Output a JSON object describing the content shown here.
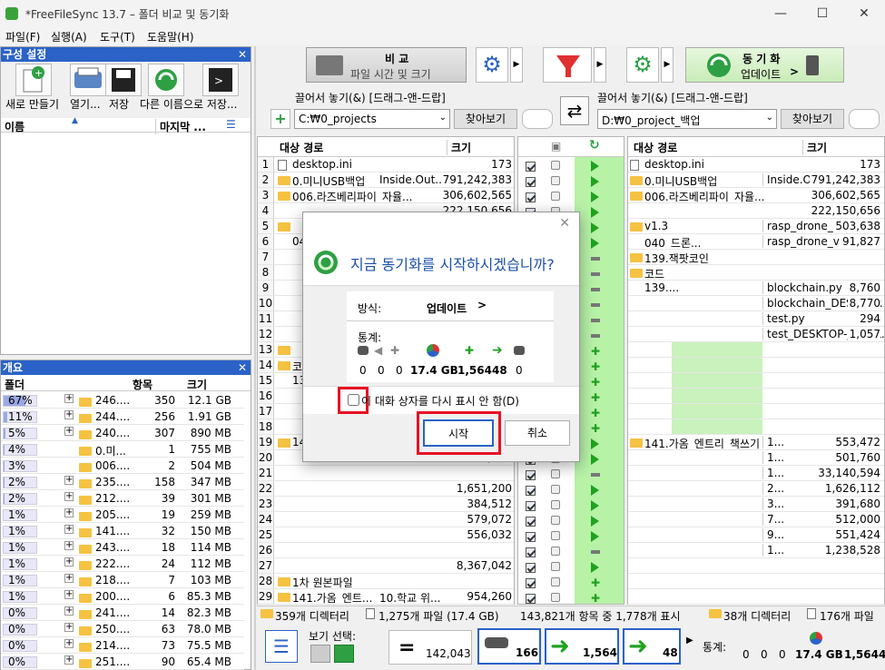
{
  "window": {
    "title": "*FreeFileSync 13.7 – 폴더 비교 및 동기화",
    "min": "—",
    "max": "☐",
    "close": "✕"
  },
  "menu": [
    "파일(F)",
    "실행(A)",
    "도구(T)",
    "도움말(H)"
  ],
  "config_panel": {
    "title": "구성 설정",
    "buttons": [
      "새로 만들기",
      "열기...",
      "저장",
      "다른 이름으로 저장..."
    ],
    "col_name": "이름",
    "col_last": "마지막 ...",
    "close": "✕"
  },
  "overview": {
    "title": "개요",
    "cols": [
      "폴더",
      "항목",
      "크기"
    ],
    "rows": [
      {
        "pct": "67%",
        "name": "246....",
        "items": "350",
        "size": "12.1 GB",
        "fill": 0.67
      },
      {
        "pct": "11%",
        "name": "244....",
        "items": "256",
        "size": "1.91 GB",
        "fill": 0.11
      },
      {
        "pct": "5%",
        "name": "240....",
        "items": "307",
        "size": "890 MB",
        "fill": 0.05
      },
      {
        "pct": "4%",
        "name": "0.미...",
        "items": "1",
        "size": "755 MB",
        "fill": 0.04
      },
      {
        "pct": "3%",
        "name": "006....",
        "items": "2",
        "size": "504 MB",
        "fill": 0.03
      },
      {
        "pct": "2%",
        "name": "235....",
        "items": "158",
        "size": "347 MB",
        "fill": 0.02
      },
      {
        "pct": "2%",
        "name": "212....",
        "items": "39",
        "size": "301 MB",
        "fill": 0.02
      },
      {
        "pct": "1%",
        "name": "205....",
        "items": "19",
        "size": "259 MB",
        "fill": 0.01
      },
      {
        "pct": "1%",
        "name": "141....",
        "items": "32",
        "size": "150 MB",
        "fill": 0.01
      },
      {
        "pct": "1%",
        "name": "243....",
        "items": "18",
        "size": "114 MB",
        "fill": 0.01
      },
      {
        "pct": "1%",
        "name": "222....",
        "items": "24",
        "size": "112 MB",
        "fill": 0.01
      },
      {
        "pct": "1%",
        "name": "218....",
        "items": "7",
        "size": "103 MB",
        "fill": 0.01
      },
      {
        "pct": "1%",
        "name": "200....",
        "items": "6",
        "size": "85.3 MB",
        "fill": 0.01
      },
      {
        "pct": "0%",
        "name": "241....",
        "items": "14",
        "size": "82.3 MB",
        "fill": 0.0
      },
      {
        "pct": "0%",
        "name": "250....",
        "items": "63",
        "size": "78.0 MB",
        "fill": 0.0
      },
      {
        "pct": "0%",
        "name": "214....",
        "items": "73",
        "size": "75.5 MB",
        "fill": 0.0
      },
      {
        "pct": "0%",
        "name": "251....",
        "items": "90",
        "size": "65.4 MB",
        "fill": 0.0
      }
    ]
  },
  "toolbar": {
    "compare_title": "비 교",
    "compare_sub": "파일 시간 및 크기",
    "sync_title": "동 기 화",
    "sync_sub": "업데이트"
  },
  "left_folder": {
    "drop_label": "끌어서 놓기(&) [드래그-앤-드랍]",
    "path": "C:₩0_projects",
    "browse": "찾아보기"
  },
  "right_folder": {
    "drop_label": "끌어서 놓기(&) [드래그-앤-드랍]",
    "path": "D:₩0_project_백업",
    "browse": "찾아보기"
  },
  "left_grid": {
    "col_path": "대상 경로",
    "col_size": "크기",
    "rows": [
      {
        "n": "1",
        "name": "desktop.ini",
        "size": "173",
        "icon": "doc"
      },
      {
        "n": "2",
        "name": "0.미니USB백업",
        "extra": "Inside.Out...",
        "size": "791,242,383",
        "icon": "folder"
      },
      {
        "n": "3",
        "name": "006.라즈베리파이_자율...",
        "size": "306,602,565",
        "icon": "folder"
      },
      {
        "n": "4",
        "name": "",
        "size": "222,150,656",
        "icon": ""
      },
      {
        "n": "5",
        "name": "",
        "size": "",
        "icon": "folder"
      },
      {
        "n": "6",
        "name": "040_",
        "size": "",
        "icon": ""
      },
      {
        "n": "7",
        "name": "",
        "size": "",
        "icon": ""
      },
      {
        "n": "8",
        "name": "",
        "size": "",
        "icon": ""
      },
      {
        "n": "9",
        "name": "",
        "size": "",
        "icon": ""
      },
      {
        "n": "10",
        "name": "",
        "size": "",
        "icon": ""
      },
      {
        "n": "11",
        "name": "",
        "size": "",
        "icon": ""
      },
      {
        "n": "12",
        "name": "",
        "size": "",
        "icon": ""
      },
      {
        "n": "13",
        "name": "",
        "size": "",
        "icon": "folder"
      },
      {
        "n": "14",
        "name": "코",
        "size": "",
        "icon": "folder"
      },
      {
        "n": "15",
        "name": "139.",
        "size": "",
        "icon": ""
      },
      {
        "n": "16",
        "name": "",
        "size": "",
        "icon": ""
      },
      {
        "n": "17",
        "name": "",
        "size": "",
        "icon": ""
      },
      {
        "n": "18",
        "name": "",
        "size": "",
        "icon": ""
      },
      {
        "n": "19",
        "name": "14",
        "size": "",
        "icon": "folder"
      },
      {
        "n": "20",
        "name": "",
        "size": "609,792",
        "icon": ""
      },
      {
        "n": "21",
        "name": "",
        "size": "",
        "icon": ""
      },
      {
        "n": "22",
        "name": "",
        "size": "1,651,200",
        "icon": ""
      },
      {
        "n": "23",
        "name": "",
        "size": "384,512",
        "icon": ""
      },
      {
        "n": "24",
        "name": "",
        "size": "579,072",
        "icon": ""
      },
      {
        "n": "25",
        "name": "",
        "size": "556,032",
        "icon": ""
      },
      {
        "n": "26",
        "name": "",
        "size": "",
        "icon": ""
      },
      {
        "n": "27",
        "name": "",
        "size": "8,367,042",
        "icon": ""
      },
      {
        "n": "28",
        "name": "1차 원본파일",
        "size": "",
        "icon": "folder"
      },
      {
        "n": "29",
        "name": "141.가옴_엔트...",
        "extra": "10.학교 위...",
        "size": "954,260",
        "icon": "folder"
      }
    ]
  },
  "right_grid": {
    "col_path": "대상 경로",
    "col_size": "크기",
    "rows": [
      {
        "name": "desktop.ini",
        "size": "173",
        "icon": "doc"
      },
      {
        "name": "0.미니USB백업",
        "extra": "Inside.Out...",
        "size": "791,242,383",
        "icon": "folder"
      },
      {
        "name": "006.라즈베리파이_자율...",
        "size": "306,602,565",
        "icon": "folder"
      },
      {
        "name": "",
        "size": "222,150,656",
        "icon": ""
      },
      {
        "name": "v1.3",
        "extra": "rasp_drone_v13.pcb",
        "size": "503,638",
        "icon": "folder"
      },
      {
        "name": "040_드론...",
        "extra": "rasp_drone_v13.sch",
        "size": "91,827",
        "icon": ""
      },
      {
        "name": "139.잭팟코인",
        "size": "",
        "icon": "folder"
      },
      {
        "name": "코드",
        "size": "",
        "icon": "folder"
      },
      {
        "name": "139....",
        "extra": "blockchain.py",
        "size": "8,760",
        "icon": ""
      },
      {
        "name": "",
        "extra": "blockchain_DESKTOP...",
        "size": "8,770",
        "icon": ""
      },
      {
        "name": "",
        "extra": "test.py",
        "size": "294",
        "icon": ""
      },
      {
        "name": "",
        "extra": "test_DESKTOP-JADGL...",
        "size": "1,057",
        "icon": ""
      },
      {
        "name": "",
        "size": "",
        "icon": ""
      },
      {
        "name": "",
        "size": "",
        "icon": ""
      },
      {
        "name": "",
        "size": "",
        "icon": ""
      },
      {
        "name": "",
        "size": "",
        "icon": ""
      },
      {
        "name": "",
        "size": "",
        "icon": ""
      },
      {
        "name": "",
        "size": "",
        "icon": ""
      },
      {
        "name": "141.가옴_엔트리_책쓰기",
        "extra": "1...",
        "size": "553,472",
        "icon": "folder"
      },
      {
        "name": "",
        "extra": "1...",
        "size": "501,760",
        "icon": ""
      },
      {
        "name": "",
        "extra": "1...",
        "size": "33,140,594",
        "icon": ""
      },
      {
        "name": "",
        "extra": "2...",
        "size": "1,626,112",
        "icon": ""
      },
      {
        "name": "",
        "extra": "3...",
        "size": "391,680",
        "icon": ""
      },
      {
        "name": "",
        "extra": "7...",
        "size": "512,000",
        "icon": ""
      },
      {
        "name": "",
        "extra": "9...",
        "size": "551,424",
        "icon": ""
      },
      {
        "name": "",
        "extra": "1...",
        "size": "1,238,528",
        "icon": ""
      },
      {
        "name": "",
        "size": "",
        "icon": ""
      },
      {
        "name": "",
        "size": "",
        "icon": ""
      },
      {
        "name": "",
        "size": "",
        "icon": ""
      }
    ]
  },
  "actions": [
    "arrow",
    "arrow",
    "arrow",
    "arrow",
    "arrow",
    "arrow",
    "dash",
    "dash",
    "dash",
    "dash",
    "dash",
    "dash",
    "add",
    "add",
    "add",
    "add",
    "add",
    "add",
    "arrow",
    "arrow",
    "dash",
    "arrow",
    "arrow",
    "arrow",
    "arrow",
    "dash",
    "arrow",
    "add",
    "add"
  ],
  "dialog": {
    "question": "지금 동기화를 시작하시겠습니까?",
    "method_label": "방식:",
    "method_value": "업데이트",
    "stats_label": "통계:",
    "stats": [
      "0",
      "0",
      "0",
      "17.4 GB",
      "1,564",
      "48",
      "0"
    ],
    "checkbox_label": "이 대화 상자를 다시 표시 안 함(D)",
    "start": "시작",
    "cancel": "취소",
    "close": "✕"
  },
  "status_left": {
    "dirs": "359개 디렉터리",
    "files": "1,275개 파일 (17.4 GB)"
  },
  "status_center": "143,821개 항목 중 1,778개 표시",
  "status_right": {
    "dirs": "38개 디렉터리",
    "files": "176개 파일 (2"
  },
  "bottom": {
    "view_label": "보기 선택:",
    "equal_count": "142,043",
    "counts": [
      "166",
      "1,564",
      "48"
    ],
    "stats_label": "통계:",
    "stats": [
      "0",
      "0",
      "0",
      "17.4 GB",
      "1,564",
      "4"
    ]
  },
  "colors": {
    "accent": "#2a62c7",
    "green": "#1fa31f",
    "highlight": "#e81123"
  }
}
